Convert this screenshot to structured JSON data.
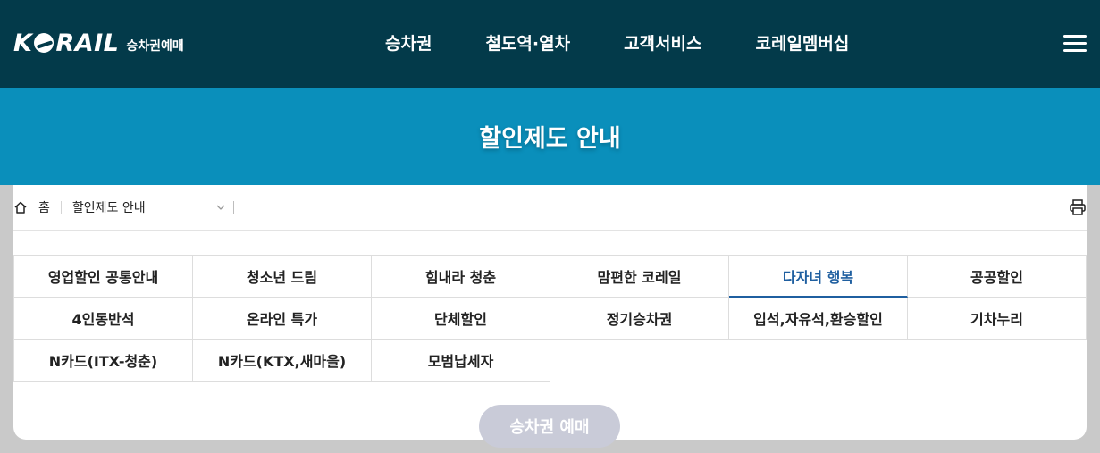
{
  "header": {
    "logo_text": "KORAIL",
    "logo_sub": "승차권예매",
    "nav": [
      "승차권",
      "철도역·열차",
      "고객서비스",
      "코레일멤버십"
    ]
  },
  "hero": {
    "title": "할인제도 안내"
  },
  "breadcrumb": {
    "home": "홈",
    "current": "할인제도 안내"
  },
  "tabs": [
    {
      "label": "영업할인 공통안내",
      "active": false
    },
    {
      "label": "청소년 드림",
      "active": false
    },
    {
      "label": "힘내라 청춘",
      "active": false
    },
    {
      "label": "맘편한 코레일",
      "active": false
    },
    {
      "label": "다자녀 행복",
      "active": true
    },
    {
      "label": "공공할인",
      "active": false
    },
    {
      "label": "4인동반석",
      "active": false
    },
    {
      "label": "온라인 특가",
      "active": false
    },
    {
      "label": "단체할인",
      "active": false
    },
    {
      "label": "정기승차권",
      "active": false
    },
    {
      "label": "입석,자유석,환승할인",
      "active": false
    },
    {
      "label": "기차누리",
      "active": false
    },
    {
      "label": "N카드(ITX-청춘)",
      "active": false
    },
    {
      "label": "N카드(KTX,새마을)",
      "active": false
    },
    {
      "label": "모범납세자",
      "active": false
    }
  ],
  "book_button": "승차권 예매",
  "colors": {
    "header_bg": "#033a4a",
    "hero_bg": "#0a8fbb",
    "active_tab": "#1f5fa0"
  }
}
